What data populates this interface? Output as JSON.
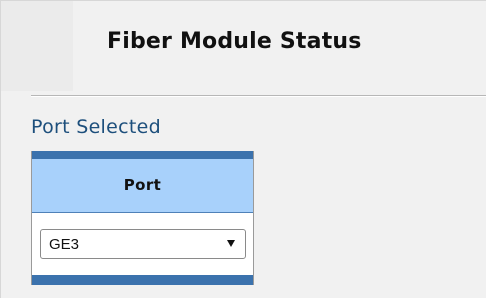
{
  "header": {
    "title": "Fiber Module Status"
  },
  "section": {
    "title": "Port Selected"
  },
  "port_table": {
    "column_header": "Port",
    "selected_port": "GE3"
  },
  "colors": {
    "section_title": "#1d4f7c",
    "table_header": "#a8d1fb",
    "table_bar": "#3b72ad",
    "background": "#f1f1f1"
  },
  "icons": {
    "select_arrow": "chevron-down-icon"
  }
}
